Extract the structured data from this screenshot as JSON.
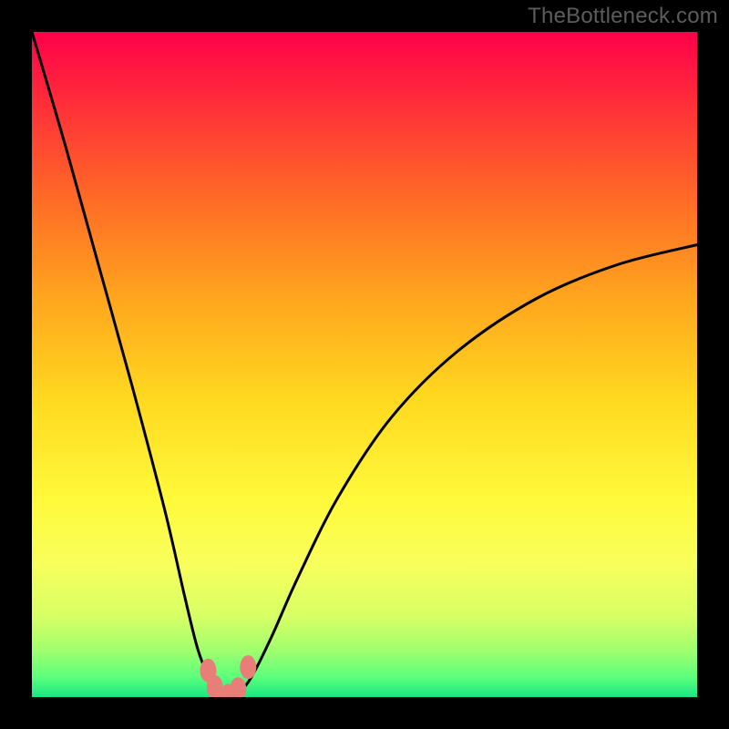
{
  "watermark": "TheBottleneck.com",
  "chart_data": {
    "type": "line",
    "title": "",
    "xlabel": "",
    "ylabel": "",
    "xlim": [
      0,
      100
    ],
    "ylim": [
      0,
      100
    ],
    "series": [
      {
        "name": "curve",
        "x": [
          0,
          5,
          10,
          15,
          20,
          23,
          25,
          27,
          28,
          29,
          30,
          31,
          33,
          36,
          40,
          46,
          54,
          64,
          76,
          88,
          100
        ],
        "values": [
          100,
          83,
          65,
          47,
          28,
          15,
          7,
          2,
          0.5,
          0,
          0,
          0.5,
          3,
          9,
          18,
          30,
          42,
          52,
          60,
          65,
          68
        ]
      }
    ],
    "markers": [
      {
        "name": "dot-left-up",
        "x": 26.5,
        "y": 4.0
      },
      {
        "name": "dot-left-down",
        "x": 27.5,
        "y": 1.5
      },
      {
        "name": "dot-bottom",
        "x": 29.5,
        "y": 0.2
      },
      {
        "name": "dot-right-down",
        "x": 31.0,
        "y": 1.2
      },
      {
        "name": "dot-right-up",
        "x": 32.5,
        "y": 4.5
      }
    ],
    "gradient_stops": [
      {
        "offset": 0.0,
        "color": "#ff004a"
      },
      {
        "offset": 0.1,
        "color": "#ff2b3a"
      },
      {
        "offset": 0.25,
        "color": "#ff6a26"
      },
      {
        "offset": 0.4,
        "color": "#ffa51e"
      },
      {
        "offset": 0.55,
        "color": "#ffd81f"
      },
      {
        "offset": 0.7,
        "color": "#fff93a"
      },
      {
        "offset": 0.8,
        "color": "#f8ff5c"
      },
      {
        "offset": 0.88,
        "color": "#d6ff66"
      },
      {
        "offset": 0.93,
        "color": "#a0ff6e"
      },
      {
        "offset": 0.97,
        "color": "#5cff7c"
      },
      {
        "offset": 1.0,
        "color": "#17e884"
      }
    ],
    "marker_color": "#e77f78",
    "curve_color": "#000000"
  }
}
